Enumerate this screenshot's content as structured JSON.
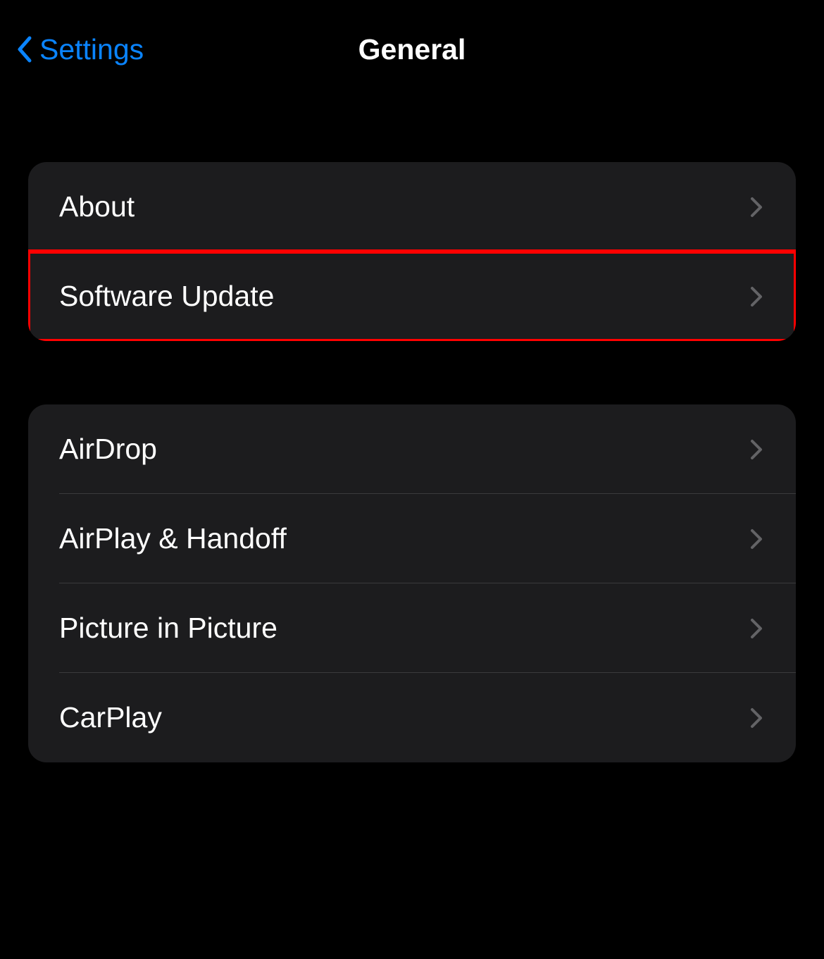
{
  "nav": {
    "back_label": "Settings",
    "title": "General"
  },
  "groups": [
    {
      "rows": [
        {
          "id": "about",
          "label": "About",
          "highlighted": false
        },
        {
          "id": "software-update",
          "label": "Software Update",
          "highlighted": true
        }
      ]
    },
    {
      "rows": [
        {
          "id": "airdrop",
          "label": "AirDrop",
          "highlighted": false
        },
        {
          "id": "airplay-handoff",
          "label": "AirPlay & Handoff",
          "highlighted": false
        },
        {
          "id": "picture-in-picture",
          "label": "Picture in Picture",
          "highlighted": false
        },
        {
          "id": "carplay",
          "label": "CarPlay",
          "highlighted": false
        }
      ]
    }
  ],
  "colors": {
    "accent": "#0a84ff",
    "background": "#000000",
    "group_bg": "#1c1c1e",
    "separator": "#3a3a3c",
    "disclosure": "#636366",
    "highlight": "#ff0000"
  }
}
